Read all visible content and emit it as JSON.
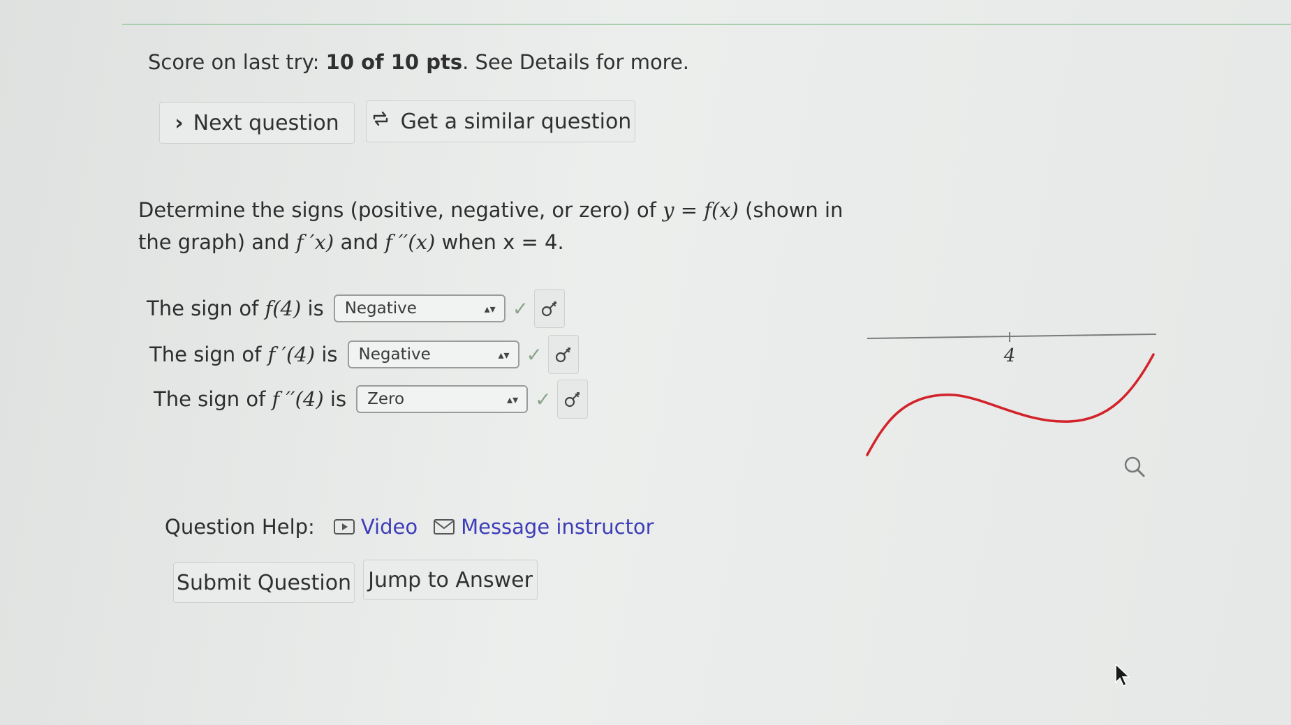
{
  "score": {
    "prefix": "Score on last try: ",
    "points": "10 of 10 pts",
    "suffix": ". See Details for more."
  },
  "buttons": {
    "next": "Next question",
    "similar": "Get a similar question",
    "submit": "Submit Question",
    "jump": "Jump to Answer"
  },
  "prompt": {
    "part1": "Determine the signs (positive, negative, or zero) of ",
    "math1": "y = f(x)",
    "part2": " (shown in the graph) and ",
    "math2": "f ′x)",
    "part3": " and ",
    "math3": "f ′′(x)",
    "part4": " when x = 4."
  },
  "rows": [
    {
      "label_prefix": "The sign of ",
      "label_math": "f(4)",
      "label_suffix": " is",
      "value": "Negative"
    },
    {
      "label_prefix": "The sign of ",
      "label_math": "f ′(4)",
      "label_suffix": " is",
      "value": "Negative"
    },
    {
      "label_prefix": "The sign of ",
      "label_math": "f ′′(4)",
      "label_suffix": " is",
      "value": "Zero"
    }
  ],
  "help": {
    "label": "Question Help:",
    "video": "Video",
    "message": "Message instructor"
  },
  "graph": {
    "tick_label": "4",
    "curve_color": "#d2232a"
  },
  "icons": {
    "next": "chevron-right-icon",
    "similar": "refresh-icon",
    "check": "checkmark-icon",
    "key": "key-icon",
    "video": "video-icon",
    "message": "mail-icon",
    "magnifier": "magnifier-icon",
    "cursor": "mouse-cursor-icon"
  }
}
